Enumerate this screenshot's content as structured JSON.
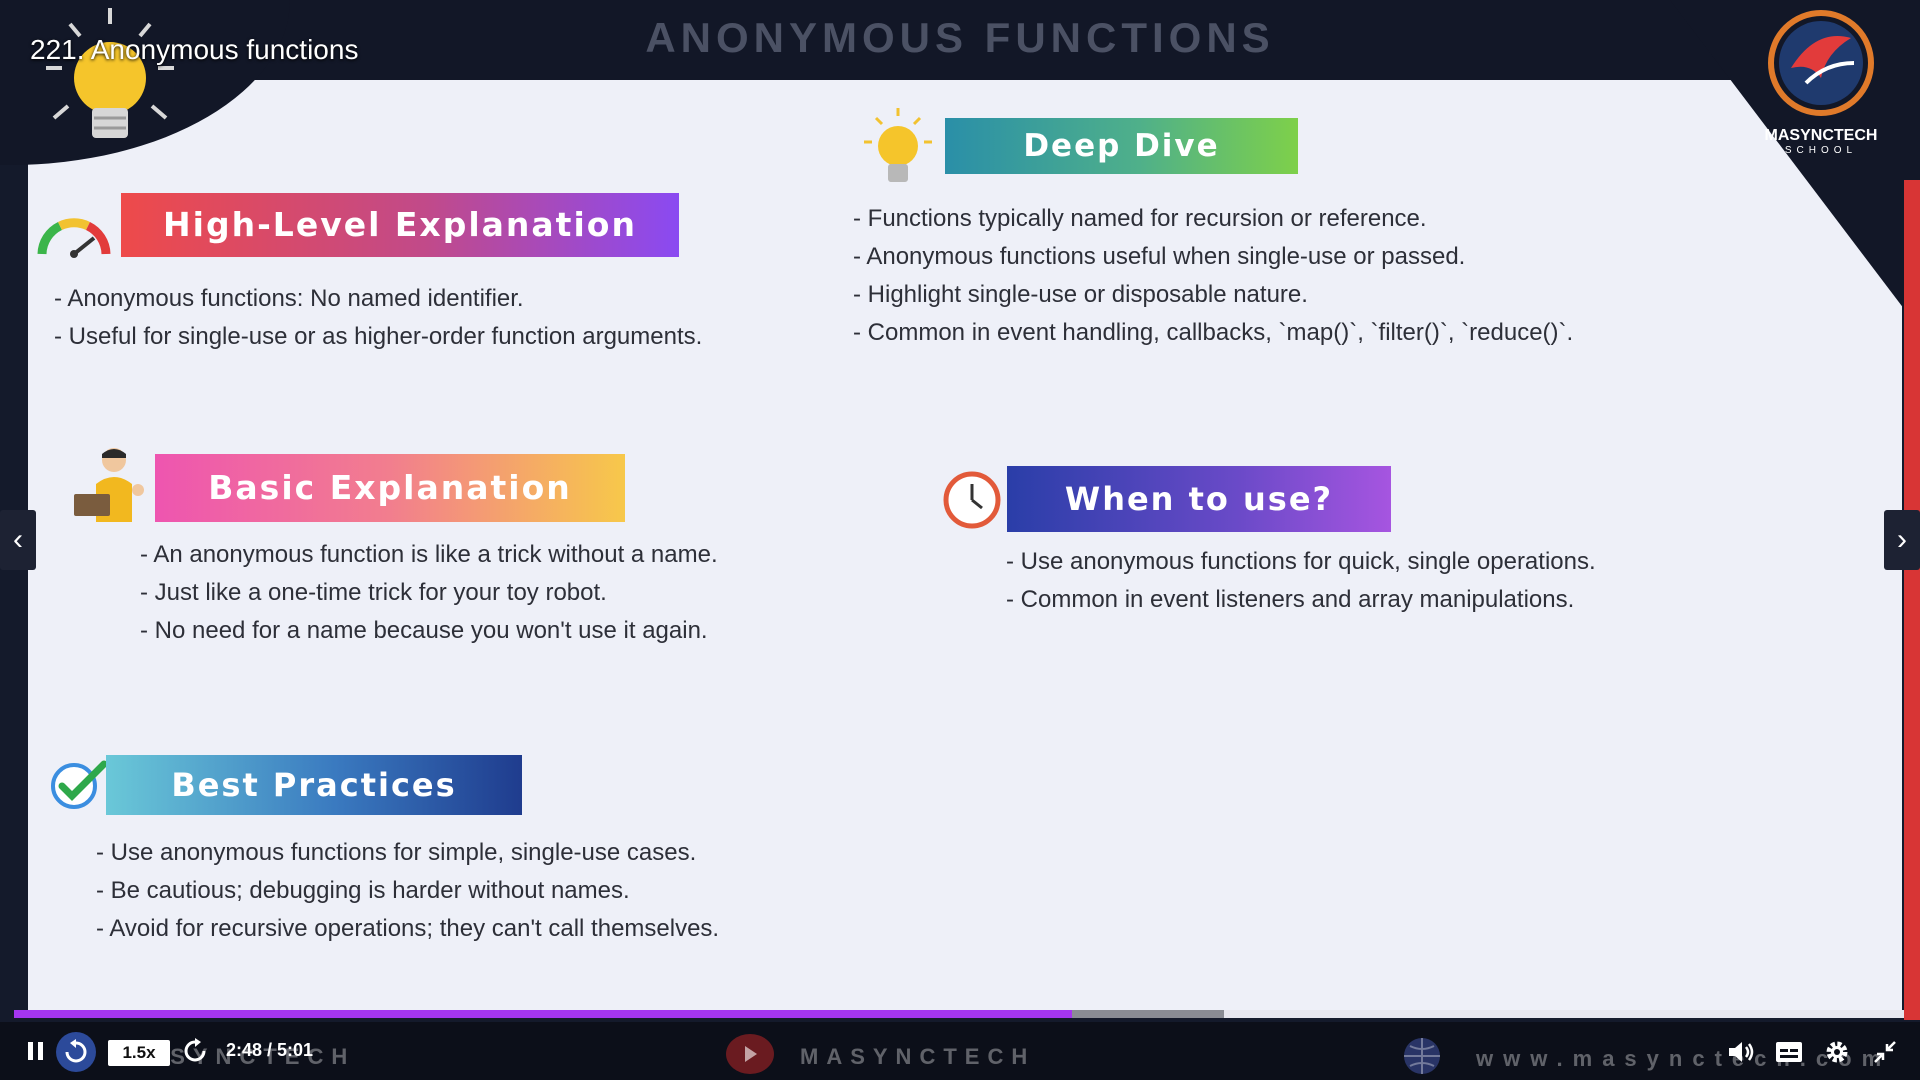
{
  "video": {
    "title": "221. Anonymous functions",
    "slide_title": "ANONYMOUS FUNCTIONS",
    "logo": {
      "name": "MASYNCTECH",
      "sub": "SCHOOL"
    }
  },
  "sections": {
    "high_level": {
      "title": "High-Level Explanation",
      "bullets": [
        "- Anonymous functions: No named identifier.",
        "- Useful for single-use or as higher-order function arguments."
      ]
    },
    "deep_dive": {
      "title": "Deep Dive",
      "bullets": [
        "- Functions typically named for recursion or reference.",
        "- Anonymous functions useful when single-use or passed.",
        "- Highlight single-use or disposable nature.",
        "- Common in event handling, callbacks, `map()`, `filter()`, `reduce()`."
      ]
    },
    "basic": {
      "title": "Basic Explanation",
      "bullets": [
        "- An anonymous function is like a trick without a name.",
        "- Just like a one-time trick for your toy robot.",
        "- No need for a name because you won't use it again."
      ]
    },
    "when": {
      "title": "When to use?",
      "bullets": [
        "- Use anonymous functions for quick, single operations.",
        "- Common in event listeners and array manipulations."
      ]
    },
    "best": {
      "title": "Best Practices",
      "bullets": [
        "- Use anonymous functions for simple, single-use cases.",
        "- Be cautious; debugging is harder without names.",
        "- Avoid for recursive operations; they can't call themselves."
      ]
    }
  },
  "player": {
    "speed": "1.5x",
    "time": "2:48 / 5:01",
    "progress": 0.56,
    "buffered": 0.64,
    "watermark_brand": "MASYNCTECH",
    "watermark_url": "www.masynctech.com"
  },
  "colors": {
    "accent": "#a435f0"
  }
}
